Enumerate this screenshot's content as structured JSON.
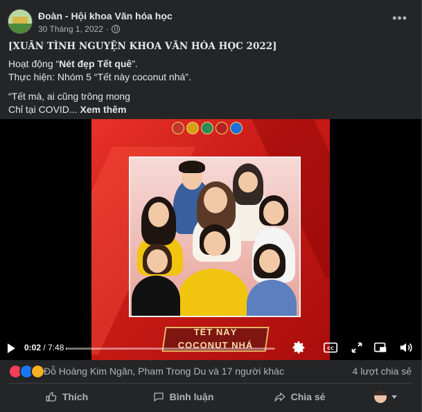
{
  "post": {
    "page_name": "Đoàn - Hội khoa Văn hóa học",
    "date": "30 Tháng 1, 2022",
    "dot": "·",
    "title": "[XUÂN TÌNH NGUYỆN KHOA VĂN HÓA HỌC 2022]",
    "line1_prefix": "Hoạt động “",
    "line1_bold": "Nét đẹp Tết quê",
    "line1_suffix": "”.",
    "line2": "Thực hiện: Nhóm 5 “Tết này coconut nhá”.",
    "line3": "“Tết mà, ai cũng trông mong",
    "line4_prefix": "Chỉ tại COVID...",
    "see_more": "Xem thêm"
  },
  "video": {
    "banner_line1": "TẾT NÀY",
    "banner_line2": "COCONUT NHÁ",
    "current_time": "0:02",
    "separator": " / ",
    "duration": "7:48",
    "progress_fraction": 0.004
  },
  "reactions": {
    "names": "Đỗ Hoàng Kim Ngân, Pham Trong Du và 17 người khác",
    "shares": "4 lượt chia sẻ"
  },
  "actions": {
    "like": "Thích",
    "comment": "Bình luận",
    "share": "Chia sẻ"
  },
  "colors": {
    "background": "#242526",
    "text": "#e4e6eb",
    "secondary": "#b0b3b8",
    "video_red": "#d0201b"
  }
}
